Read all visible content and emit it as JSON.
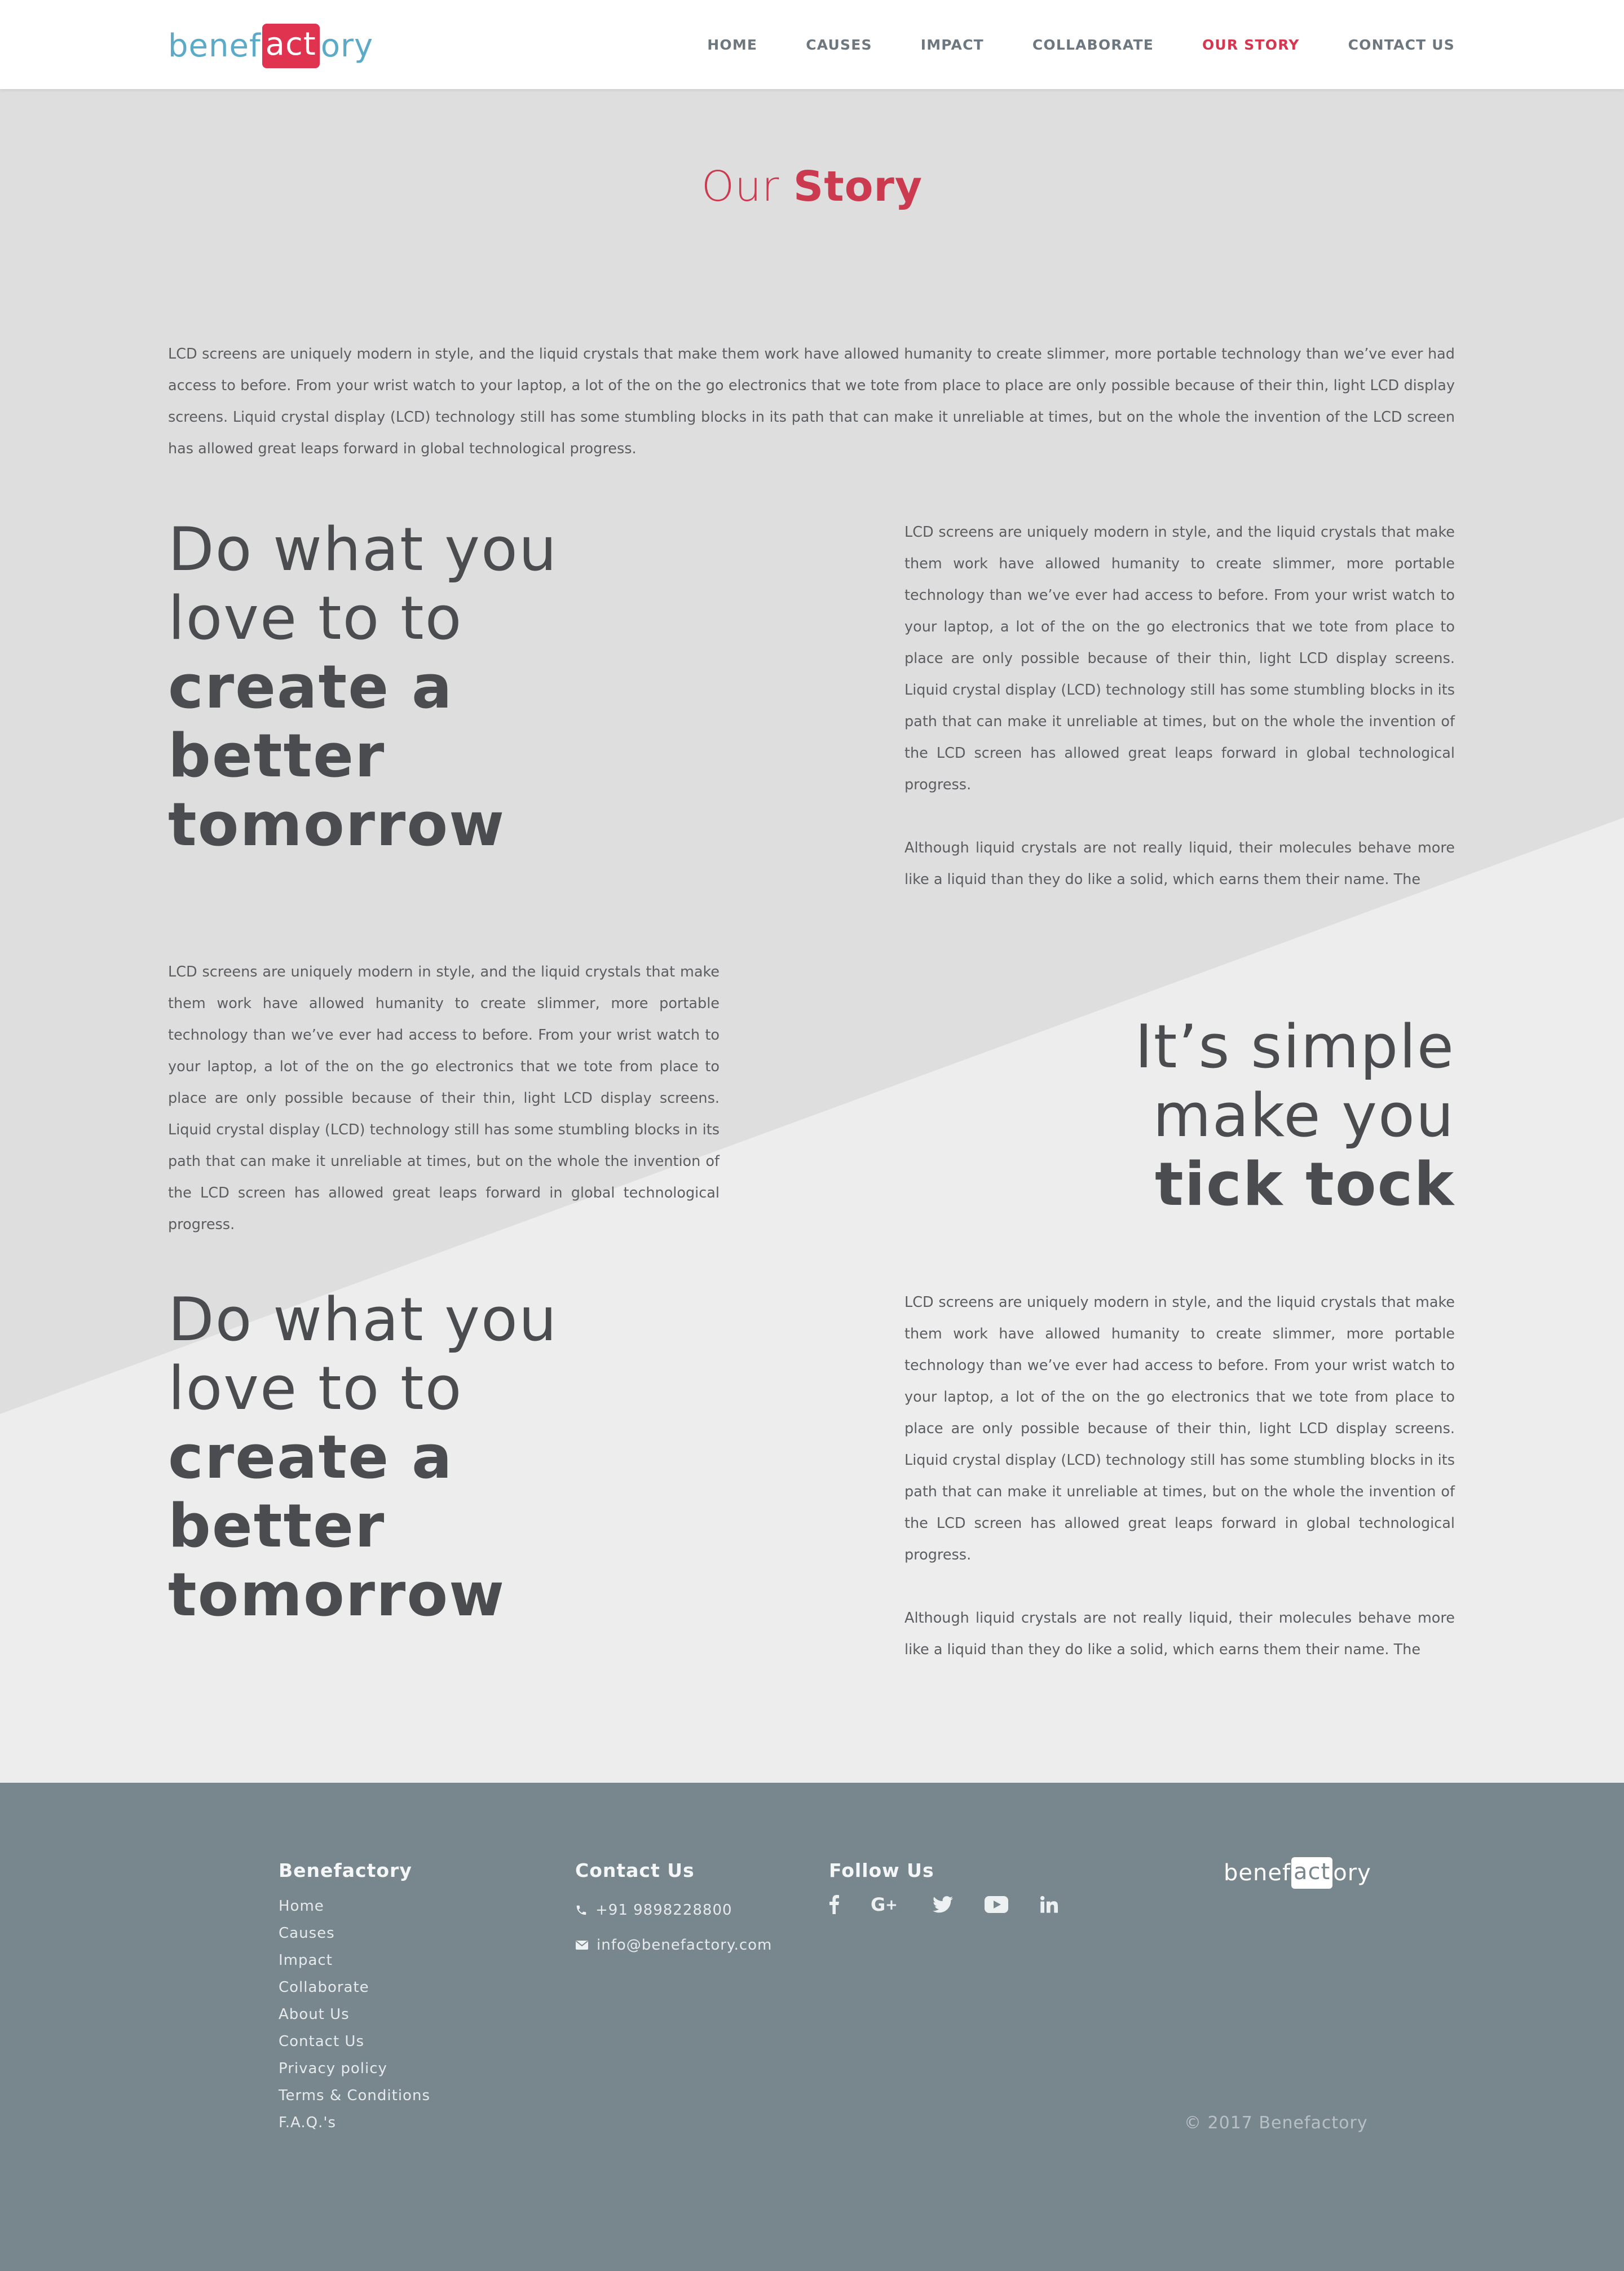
{
  "colors": {
    "accent": "#d6364f",
    "logo_blue": "#5aaac8",
    "footer_bg": "#78878e",
    "bg_dark": "#dededf",
    "bg_light": "#ededed"
  },
  "header": {
    "logo": {
      "pre": "benef",
      "act": "act",
      "post": "ory"
    },
    "nav": [
      "HOME",
      "CAUSES",
      "IMPACT",
      "COLLABORATE",
      "OUR STORY",
      "CONTACT US"
    ],
    "active_nav": "OUR STORY"
  },
  "page_title": {
    "light": "Our ",
    "bold": "Story"
  },
  "intro": "LCD screens are uniquely modern in style, and the liquid crystals that make them work have allowed humanity to create slimmer, more portable technology than we’ve ever had access to before. From your wrist watch to your laptop, a lot of the on the go electronics that we tote from place to place are only possible because of their thin, light LCD display screens. Liquid crystal display (LCD) technology still has some stumbling blocks in its path that can make it unreliable at times, but on the whole the invention of the LCD screen has allowed great leaps forward in global technological progress.",
  "section1": {
    "headline": {
      "line1": "Do what you",
      "line2": "love to to",
      "bold1": "create a",
      "bold2": "better",
      "bold3": "tomorrow"
    },
    "para1": "LCD screens are uniquely modern in style, and the liquid crystals that make them work have allowed humanity to create slimmer, more portable technology than we’ve ever had access to before. From your wrist watch to your laptop, a lot of the on the go electronics that we tote from place to place are only possible because of their thin, light LCD display screens. Liquid crystal display (LCD) technology still has some stumbling blocks in its path that can make it unreliable at times, but on the whole the invention of the LCD screen has allowed great leaps forward in global technological progress.",
    "para2": "Although liquid crystals are not really liquid, their molecules behave more like a liquid than they do like a solid, which earns them their name. The"
  },
  "section2": {
    "para": "LCD screens are uniquely modern in style, and the liquid crystals that make them work have allowed humanity to create slimmer, more portable technology than we’ve ever had access to before. From your wrist watch to your laptop, a lot of the on the go electronics that we tote from place to place are only possible because of their thin, light LCD display screens. Liquid crystal display (LCD) technology still has some stumbling blocks in its path that can make it unreliable at times, but on the whole the invention of the LCD screen has allowed great leaps forward in global technological progress.",
    "headline": {
      "line1": "It’s simple",
      "line2": "make you",
      "bold1": "tick tock"
    }
  },
  "section3": {
    "headline": {
      "line1": "Do what you",
      "line2": "love to to",
      "bold1": "create a",
      "bold2": "better",
      "bold3": "tomorrow"
    },
    "para1": "LCD screens are uniquely modern in style, and the liquid crystals that make them work have allowed humanity to create slimmer, more portable technology than we’ve ever had access to before. From your wrist watch to your laptop, a lot of the on the go electronics that we tote from place to place are only possible because of their thin, light LCD display screens. Liquid crystal display (LCD) technology still has some stumbling blocks in its path that can make it unreliable at times, but on the whole the invention of the LCD screen has allowed great leaps forward in global technological progress.",
    "para2": "Although liquid crystals are not really liquid, their molecules behave more like a liquid than they do like a solid, which earns them their name. The"
  },
  "footer": {
    "brand_heading": "Benefactory",
    "links": [
      "Home",
      "Causes",
      "Impact",
      "Collaborate",
      "About Us",
      "Contact Us",
      "Privacy policy",
      "Terms & Conditions",
      "F.A.Q.'s"
    ],
    "contact_heading": "Contact Us",
    "phone": "+91 9898228800",
    "email": "info@benefactory.com",
    "follow_heading": "Follow Us",
    "social_icons": [
      "facebook-icon",
      "google-plus-icon",
      "twitter-icon",
      "youtube-icon",
      "linkedin-icon"
    ],
    "logo": {
      "pre": "benef",
      "act": "act",
      "post": "ory"
    },
    "copyright": "© 2017 Benefactory"
  }
}
